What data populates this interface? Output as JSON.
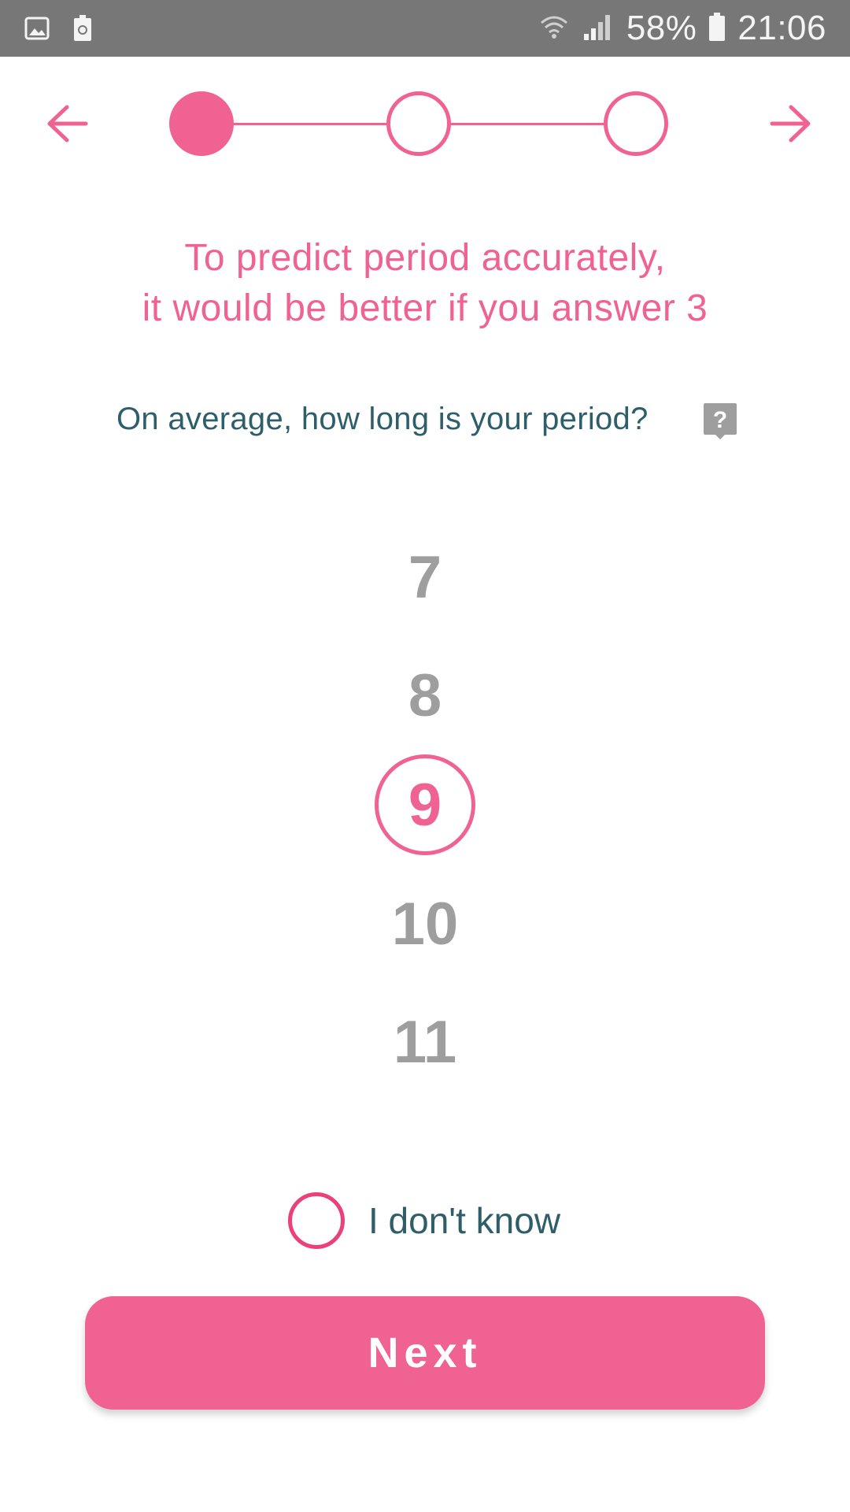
{
  "status_bar": {
    "battery_percent": "58%",
    "time": "21:06",
    "left_icons": [
      "image-icon",
      "recycle-battery-icon"
    ],
    "right_icons": [
      "wifi-icon",
      "signal-icon",
      "battery-icon"
    ]
  },
  "stepper": {
    "total_steps": 3,
    "current_step": 1,
    "back_icon": "arrow-left-icon",
    "forward_icon": "arrow-right-icon"
  },
  "headline": {
    "line1": "To predict period accurately,",
    "line2": "it would be better if you answer 3"
  },
  "question": {
    "text": "On average, how long is your period?",
    "help_icon": "question-help-icon"
  },
  "picker": {
    "visible_values": [
      "7",
      "8",
      "9",
      "10",
      "11"
    ],
    "selected": "9"
  },
  "dont_know": {
    "label": "I don't know",
    "checked": false
  },
  "next_button": {
    "label": "Next"
  },
  "colors": {
    "accent": "#f06292",
    "text_dark": "#2f5e6b",
    "inactive_number": "#9e9e9e",
    "status_bar": "#777777"
  }
}
